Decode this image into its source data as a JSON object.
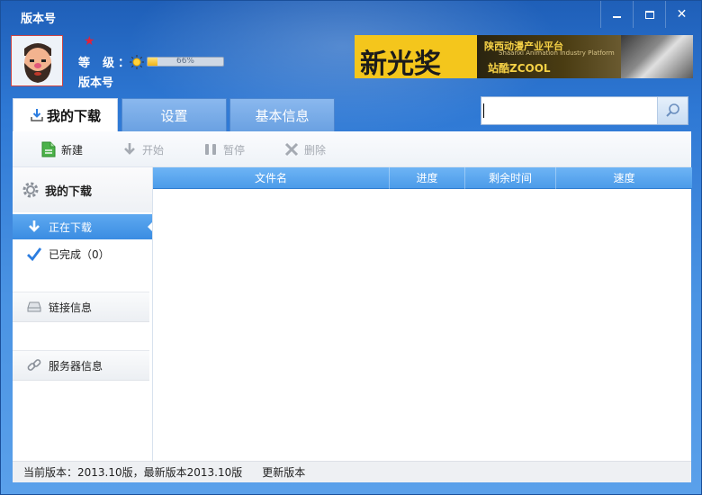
{
  "window": {
    "title": "版本号",
    "controls": {
      "minimize": "minimize-icon",
      "maximize": "maximize-icon",
      "close": "close-icon"
    }
  },
  "user": {
    "avatar": "avatar-cartoon-man",
    "level_label": "等级",
    "level_colon": "：",
    "level_progress_percent": 66,
    "level_progress_text": "66%",
    "version_name": "版本号"
  },
  "banner": {
    "brand_text": "新光奖",
    "org_text": "陕西动漫产业平台",
    "org_subtitle": "Shaanxi Animation Industry Platform",
    "partner_text": "站酷ZCOOL"
  },
  "tabs": [
    {
      "label": "我的下载",
      "active": true
    },
    {
      "label": "设置",
      "active": false
    },
    {
      "label": "基本信息",
      "active": false
    }
  ],
  "search": {
    "value": "",
    "placeholder": ""
  },
  "toolbar": {
    "new_label": "新建",
    "start_label": "开始",
    "pause_label": "暂停",
    "delete_label": "删除"
  },
  "sidebar": {
    "header": "我的下载",
    "items": [
      {
        "label": "正在下载",
        "active": true
      },
      {
        "label": "已完成（0）",
        "active": false
      }
    ],
    "sections": [
      {
        "label": "链接信息"
      },
      {
        "label": "服务器信息"
      }
    ]
  },
  "table": {
    "columns": [
      "文件名",
      "进度",
      "剩余时间",
      "速度"
    ],
    "rows": []
  },
  "status": {
    "version_text": "当前版本：2013.10版，最新版本2013.10版",
    "update_label": "更新版本"
  },
  "colors": {
    "accent": "#3a8ce2",
    "titlebar": "#2e78d4",
    "banner_yellow": "#f2c21a"
  }
}
